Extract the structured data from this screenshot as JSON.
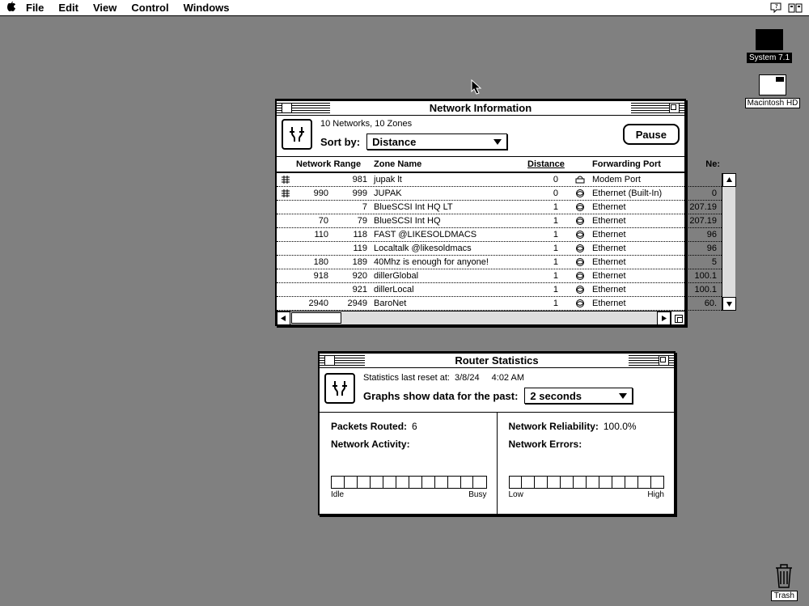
{
  "menubar": {
    "items": [
      "File",
      "Edit",
      "View",
      "Control",
      "Windows"
    ]
  },
  "desktop": {
    "icons": [
      {
        "label": "System 7.1"
      },
      {
        "label": "Macintosh HD"
      }
    ],
    "trash_label": "Trash"
  },
  "netinfo": {
    "title": "Network Information",
    "summary": "10 Networks, 10 Zones",
    "sort_label": "Sort by:",
    "sort_value": "Distance",
    "pause_label": "Pause",
    "columns": {
      "range": "Network Range",
      "zone": "Zone Name",
      "distance": "Distance",
      "port": "Forwarding Port",
      "next": "Ne:"
    },
    "rows": [
      {
        "icon": "router",
        "r1": "",
        "r2": "981",
        "zone": "jupak lt",
        "dist": "0",
        "porticon": "modem",
        "port": "Modem Port",
        "next": ""
      },
      {
        "icon": "router",
        "r1": "990",
        "r2": "999",
        "zone": "JUPAK",
        "dist": "0",
        "porticon": "ether",
        "port": "Ethernet (Built-In)",
        "next": "0"
      },
      {
        "icon": "",
        "r1": "",
        "r2": "7",
        "zone": "BlueSCSI Int HQ LT",
        "dist": "1",
        "porticon": "ether",
        "port": "Ethernet",
        "next": "207.19"
      },
      {
        "icon": "",
        "r1": "70",
        "r2": "79",
        "zone": "BlueSCSI Int HQ",
        "dist": "1",
        "porticon": "ether",
        "port": "Ethernet",
        "next": "207.19"
      },
      {
        "icon": "",
        "r1": "110",
        "r2": "118",
        "zone": "FAST @LIKESOLDMACS",
        "dist": "1",
        "porticon": "ether",
        "port": "Ethernet",
        "next": "96"
      },
      {
        "icon": "",
        "r1": "",
        "r2": "119",
        "zone": "Localtalk @likesoldmacs",
        "dist": "1",
        "porticon": "ether",
        "port": "Ethernet",
        "next": "96"
      },
      {
        "icon": "",
        "r1": "180",
        "r2": "189",
        "zone": "40Mhz is enough for anyone!",
        "dist": "1",
        "porticon": "ether",
        "port": "Ethernet",
        "next": "5"
      },
      {
        "icon": "",
        "r1": "918",
        "r2": "920",
        "zone": "dillerGlobal",
        "dist": "1",
        "porticon": "ether",
        "port": "Ethernet",
        "next": "100.1"
      },
      {
        "icon": "",
        "r1": "",
        "r2": "921",
        "zone": "dillerLocal",
        "dist": "1",
        "porticon": "ether",
        "port": "Ethernet",
        "next": "100.1"
      },
      {
        "icon": "",
        "r1": "2940",
        "r2": "2949",
        "zone": "BaroNet",
        "dist": "1",
        "porticon": "ether",
        "port": "Ethernet",
        "next": "60."
      }
    ]
  },
  "router": {
    "title": "Router Statistics",
    "reset_label": "Statistics last reset at:",
    "reset_date": "3/8/24",
    "reset_time": "4:02 AM",
    "graphs_label": "Graphs show data for the past:",
    "graphs_value": "2 seconds",
    "left": {
      "packets_label": "Packets Routed:",
      "packets_value": "6",
      "activity_label": "Network Activity:",
      "gauge_lo": "Idle",
      "gauge_hi": "Busy"
    },
    "right": {
      "reliab_label": "Network Reliability:",
      "reliab_value": "100.0%",
      "errors_label": "Network Errors:",
      "gauge_lo": "Low",
      "gauge_hi": "High"
    }
  }
}
